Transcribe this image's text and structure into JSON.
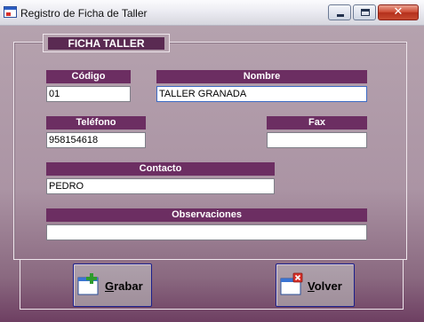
{
  "window": {
    "title": "Registro de Ficha de Taller",
    "controls": {
      "minimize": "",
      "maximize": "",
      "close": "✕"
    }
  },
  "form": {
    "group_title": "FICHA TALLER",
    "fields": {
      "codigo": {
        "label": "Código",
        "value": "01"
      },
      "nombre": {
        "label": "Nombre",
        "value": "TALLER GRANADA"
      },
      "telefono": {
        "label": "Teléfono",
        "value": "958154618"
      },
      "fax": {
        "label": "Fax",
        "value": ""
      },
      "contacto": {
        "label": "Contacto",
        "value": "PEDRO"
      },
      "observaciones": {
        "label": "Observaciones",
        "value": ""
      }
    }
  },
  "buttons": {
    "grabar": {
      "label": "Grabar",
      "icon": "new-window-plus-icon"
    },
    "volver": {
      "label": "Volver",
      "icon": "window-close-icon"
    }
  },
  "colors": {
    "label_bg": "#6c2e62",
    "form_bg": "#b5a2ae",
    "button_border": "#1b1f8c"
  }
}
